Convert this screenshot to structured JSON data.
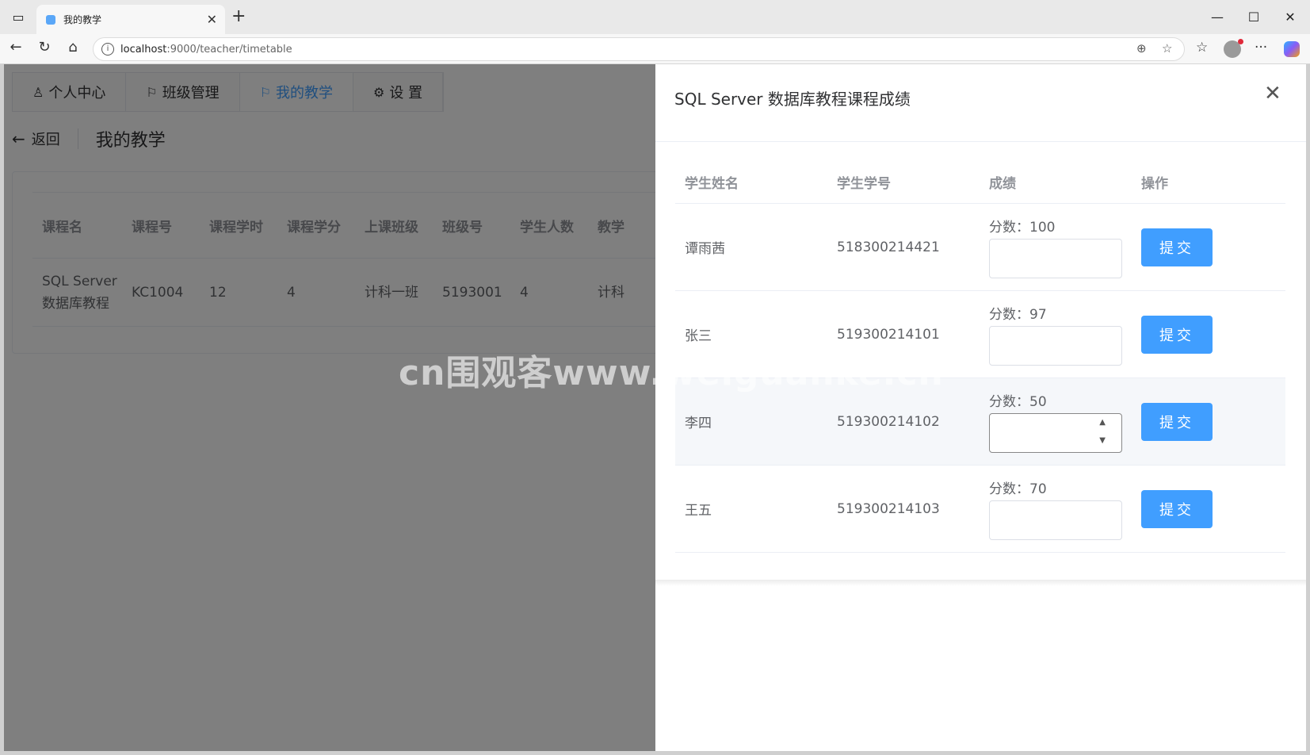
{
  "browser": {
    "tab_title": "我的教学",
    "url_host": "localhost",
    "url_path": ":9000/teacher/timetable"
  },
  "nav": {
    "items": [
      {
        "label": "个人中心",
        "icon": "user-icon"
      },
      {
        "label": "班级管理",
        "icon": "flag-icon"
      },
      {
        "label": "我的教学",
        "icon": "flag-icon",
        "active": true
      },
      {
        "label": "设 置",
        "icon": "gear-icon"
      }
    ]
  },
  "header": {
    "back_label": "返回",
    "title": "我的教学"
  },
  "course_table": {
    "columns": [
      "课程名",
      "课程号",
      "课程学时",
      "课程学分",
      "上课班级",
      "班级号",
      "学生人数",
      "教学"
    ],
    "rows": [
      {
        "name_line1": "SQL Server",
        "name_line2": "数据库教程",
        "code": "KC1004",
        "hours": "12",
        "credits": "4",
        "class": "计科一班",
        "class_no": "5193001",
        "students": "4",
        "teach": "计科"
      }
    ]
  },
  "drawer": {
    "title": "SQL Server 数据库教程课程成绩",
    "columns": [
      "学生姓名",
      "学生学号",
      "成绩",
      "操作"
    ],
    "score_prefix": "分数：",
    "submit_label": "提交",
    "rows": [
      {
        "name": "谭雨茜",
        "id": "518300214421",
        "score": "100"
      },
      {
        "name": "张三",
        "id": "519300214101",
        "score": "97"
      },
      {
        "name": "李四",
        "id": "519300214102",
        "score": "50"
      },
      {
        "name": "王五",
        "id": "519300214103",
        "score": "70"
      }
    ]
  },
  "watermark": "cn围观客www.weiguanke.cn",
  "colors": {
    "accent": "#409eff",
    "overlay": "rgba(0,0,0,0.5)"
  }
}
